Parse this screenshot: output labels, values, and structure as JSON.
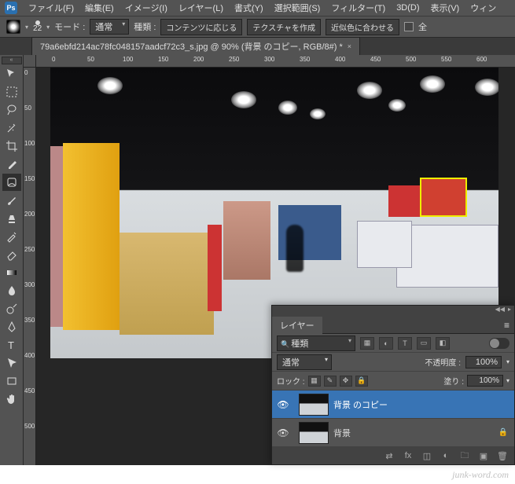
{
  "menubar": {
    "logo": "Ps",
    "items": [
      "ファイル(F)",
      "編集(E)",
      "イメージ(I)",
      "レイヤー(L)",
      "書式(Y)",
      "選択範囲(S)",
      "フィルター(T)",
      "3D(D)",
      "表示(V)",
      "ウィン"
    ]
  },
  "options": {
    "brush_size": "22",
    "mode_label": "モード :",
    "mode_value": "通常",
    "type_label": "種類 :",
    "btn_content_aware": "コンテンツに応じる",
    "btn_create_texture": "テクスチャを作成",
    "btn_proximity": "近似色に合わせる",
    "sample_all": "全"
  },
  "document": {
    "tab_title": "79a6ebfd214ac78fc048157aadcf72c3_s.jpg @ 90% (背景 のコピー, RGB/8#) *"
  },
  "ruler": {
    "h_ticks": [
      "0",
      "50",
      "100",
      "150",
      "200",
      "250",
      "300",
      "350",
      "400",
      "450",
      "500",
      "550",
      "600"
    ],
    "v_ticks": [
      "0",
      "50",
      "100",
      "150",
      "200",
      "250",
      "300",
      "350",
      "400",
      "450",
      "500"
    ]
  },
  "layers_panel": {
    "title": "レイヤー",
    "search_label": "種類",
    "blend_mode": "通常",
    "opacity_label": "不透明度 :",
    "opacity_value": "100%",
    "lock_label": "ロック :",
    "fill_label": "塗り :",
    "fill_value": "100%",
    "layers": [
      {
        "name": "背景 のコピー",
        "visible": true,
        "selected": true,
        "locked": false
      },
      {
        "name": "背景",
        "visible": true,
        "selected": false,
        "locked": true
      }
    ]
  },
  "watermark": "junk-word.com"
}
